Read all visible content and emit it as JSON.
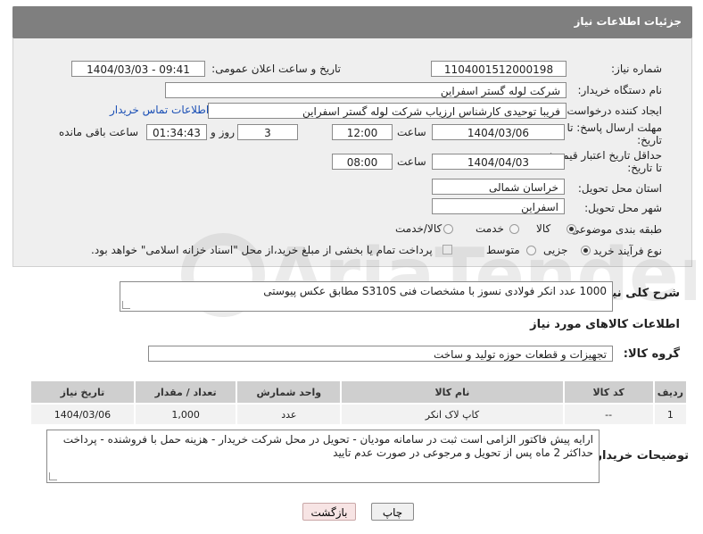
{
  "header": {
    "title": "جزئیات اطلاعات نیاز"
  },
  "form": {
    "need_number_label": "شماره نیاز:",
    "need_number": "1104001512000198",
    "announce_label": "تاریخ و ساعت اعلان عمومی:",
    "announce_value": "1404/03/03 - 09:41",
    "buyer_org_label": "نام دستگاه خریدار:",
    "buyer_org": "شرکت لوله گستر اسفراین",
    "creator_label": "ایجاد کننده درخواست:",
    "creator": "فریبا توحیدی کارشناس ارزیاب شرکت لوله گستر اسفراین",
    "contact_link": "اطلاعات تماس خریدار",
    "deadline_label_1": "مهلت ارسال پاسخ: تا",
    "deadline_label_2": "تاریخ:",
    "deadline_date": "1404/03/06",
    "time_word": "ساعت",
    "deadline_time": "12:00",
    "days_value": "3",
    "days_word": "روز و",
    "remaining_time": "01:34:43",
    "remaining_word": "ساعت باقی مانده",
    "validity_label_1": "حداقل تاریخ اعتبار قیمت:",
    "validity_label_2": "تا تاریخ:",
    "validity_date": "1404/04/03",
    "validity_time": "08:00",
    "province_label": "استان محل تحویل:",
    "province": "خراسان شمالی",
    "city_label": "شهر محل تحویل:",
    "city": "اسفراین",
    "category_label": "طبقه بندی موضوعی:",
    "category_options": [
      "کالا",
      "خدمت",
      "کالا/خدمت"
    ],
    "category_selected": "کالا",
    "process_label": "نوع فرآیند خرید :",
    "process_options": [
      "جزیی",
      "متوسط"
    ],
    "process_selected": "جزیی",
    "payment_note": "پرداخت تمام یا بخشی از مبلغ خرید،از محل \"اسناد خزانه اسلامی\" خواهد بود."
  },
  "description": {
    "label": "شرح کلی نیاز:",
    "text": "1000 عدد انکر فولادی نسوز  با مشخصات فنی S310S مطابق عکس پیوستی"
  },
  "goods": {
    "section_title": "اطلاعات کالاهای مورد نیاز",
    "group_label": "گروه کالا:",
    "group_value": "تجهیزات و قطعات حوزه تولید و ساخت",
    "columns": [
      "ردیف",
      "کد کالا",
      "نام کالا",
      "واحد شمارش",
      "تعداد / مقدار",
      "تاریخ نیاز"
    ],
    "rows": [
      {
        "row": "1",
        "code": "--",
        "name": "کاپ لاک انکر",
        "unit": "عدد",
        "qty": "1,000",
        "date": "1404/03/06"
      }
    ]
  },
  "buyer_notes": {
    "label": "توضیحات خریدار:",
    "line1": "ارایه پیش فاکتور الزامی است ثبت در سامانه مودیان - تحویل در محل شرکت خریدار - هزینه حمل با فروشنده - پرداخت",
    "line2": "حداکثر 2 ماه پس از تحویل و مرجوعی در صورت عدم تایید"
  },
  "buttons": {
    "print": "چاپ",
    "back": "بازگشت"
  },
  "colors": {
    "titlebar": "#7f7f7f",
    "link": "#1a4fb5",
    "back_button": "#f7e4e4"
  },
  "watermark_text": "AriaTender.neT"
}
